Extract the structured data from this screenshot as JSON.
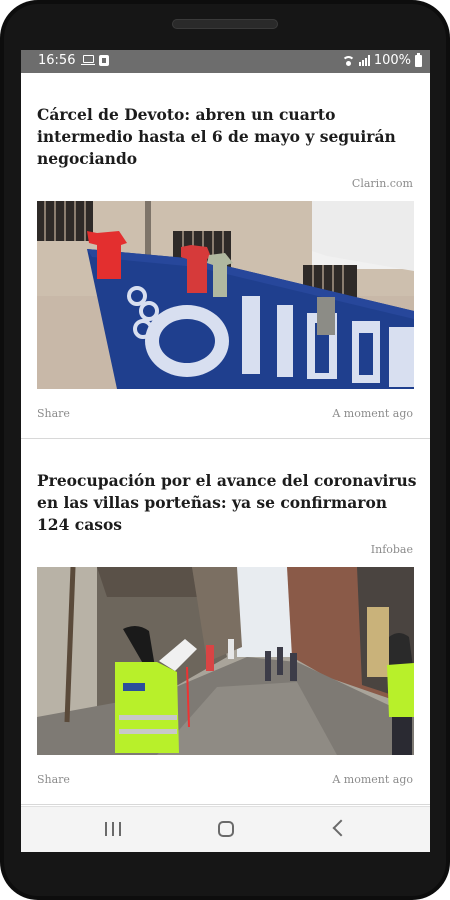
{
  "status_bar": {
    "time": "16:56",
    "battery": "100%",
    "icons": [
      "laptop-icon",
      "screenshot-icon",
      "wifi-icon",
      "signal-icon",
      "battery-icon"
    ]
  },
  "articles": [
    {
      "title": "Cárcel de Devoto: abren un cuarto intermedio hasta el 6 de mayo y seguirán negociando",
      "source": "Clarin.com",
      "share": "Share",
      "time": "A moment ago",
      "image": "prison-protest-banner-photo"
    },
    {
      "title": "Preocupación por el avance del coronavirus en las villas porteñas: ya se confirmaron 124 casos",
      "source": "Infobae",
      "share": "Share",
      "time": "A moment ago",
      "image": "villa-street-photo"
    }
  ],
  "nav": {
    "icons": [
      "recent-apps-icon",
      "home-icon",
      "back-icon"
    ]
  },
  "colors": {
    "status_bar_bg": "#6d6d6d",
    "title_text": "#1c1c1c",
    "meta_text": "#8c8c8c"
  }
}
